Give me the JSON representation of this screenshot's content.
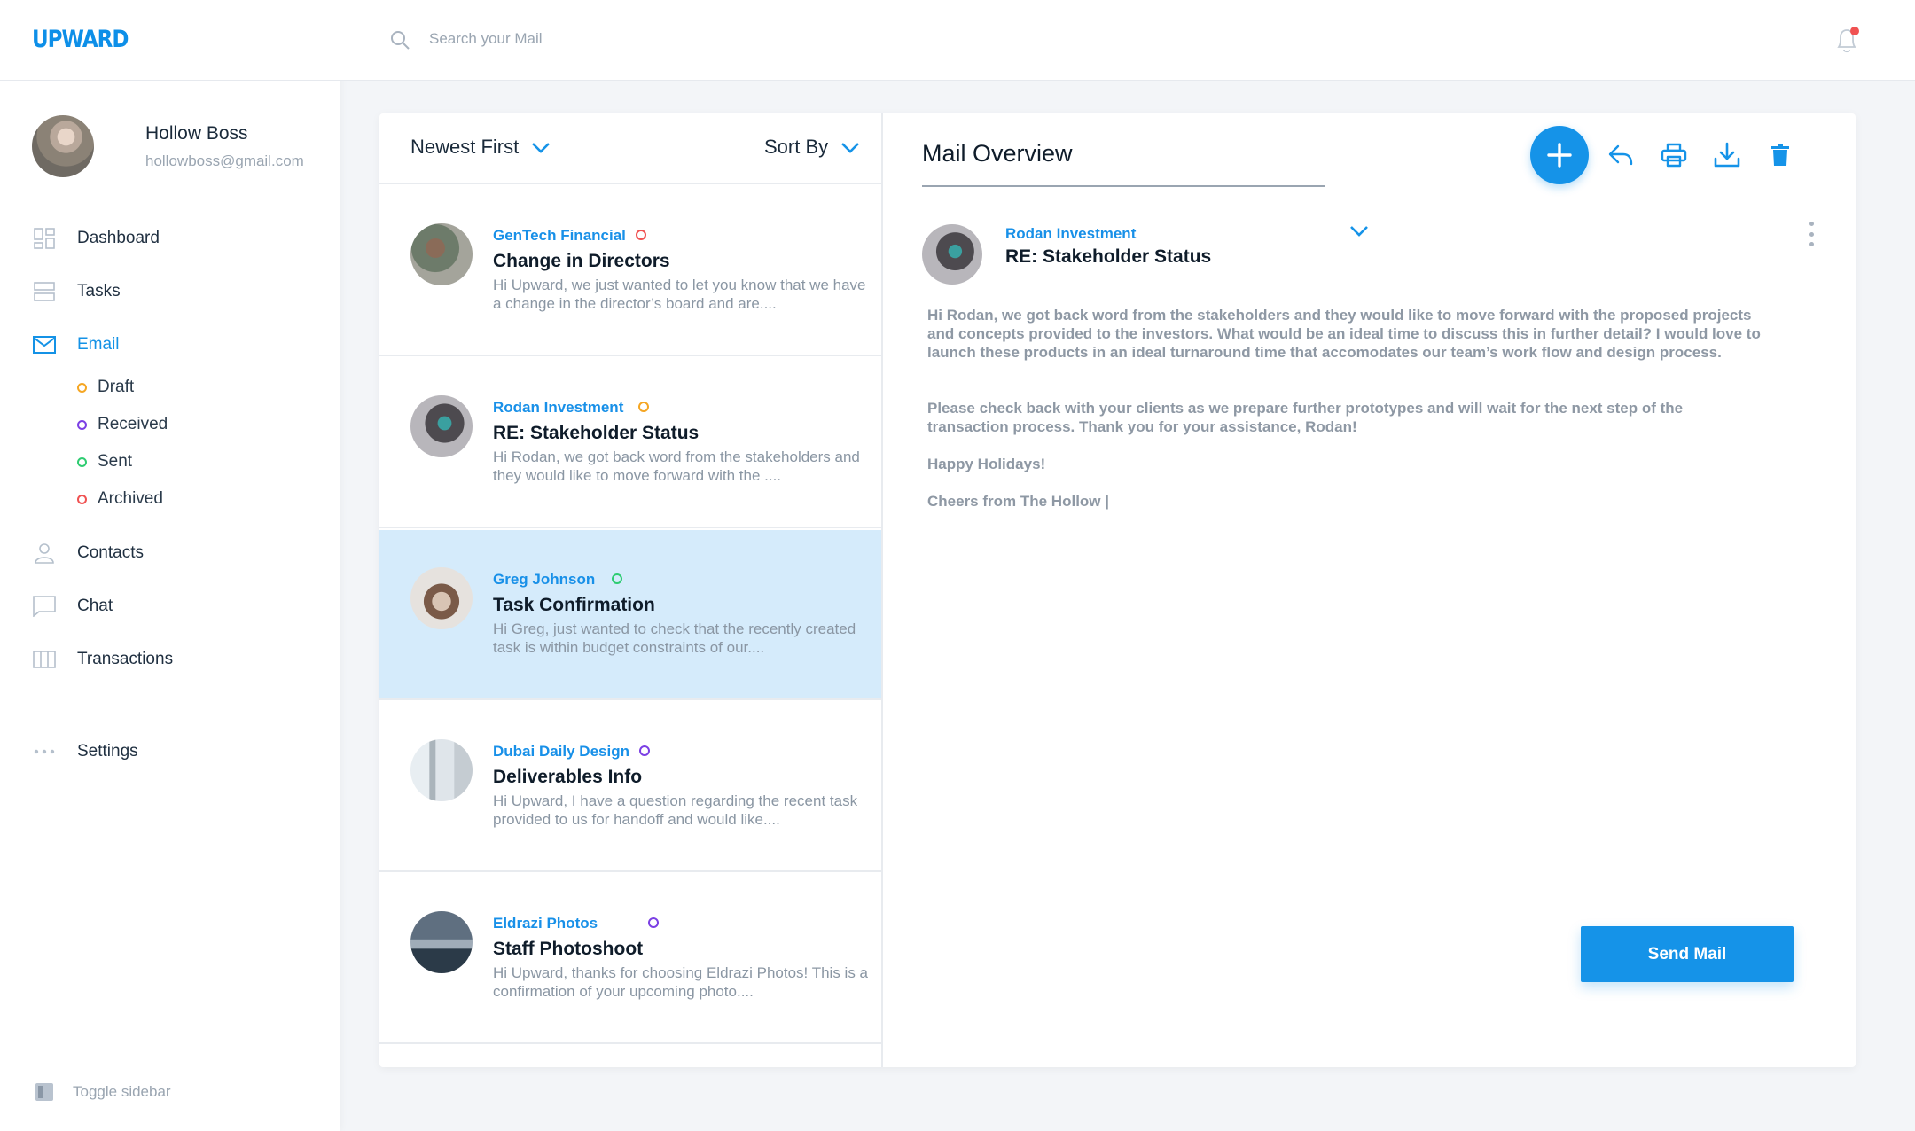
{
  "app": {
    "logo": "UPWARD"
  },
  "profile": {
    "name": "Hollow Boss",
    "email": "hollowboss@gmail.com"
  },
  "nav": {
    "dashboard": "Dashboard",
    "tasks": "Tasks",
    "email": "Email",
    "email_sub": [
      {
        "label": "Draft",
        "color": "#f5a623"
      },
      {
        "label": "Received",
        "color": "#7b3fe4"
      },
      {
        "label": "Sent",
        "color": "#2ecc71"
      },
      {
        "label": "Archived",
        "color": "#f05252"
      }
    ],
    "contacts": "Contacts",
    "chat": "Chat",
    "transactions": "Transactions",
    "settings": "Settings",
    "toggle_sidebar": "Toggle sidebar"
  },
  "search": {
    "placeholder": "Search your Mail",
    "value": ""
  },
  "notifications": {
    "has_unread": true,
    "dot_color": "#f05252"
  },
  "list": {
    "sort_order": "Newest First",
    "sort_by": "Sort By",
    "items": [
      {
        "sender": "GenTech Financial",
        "subject": "Change in Directors",
        "preview": "Hi Upward, we just wanted to let you know that we have a change in the director’s board and are....",
        "tag_color": "#f05252",
        "selected": false
      },
      {
        "sender": "Rodan Investment",
        "subject": "RE: Stakeholder Status",
        "preview": "Hi Rodan, we got back word from the stakeholders and they would like to move forward with the ....",
        "tag_color": "#f5a623",
        "selected": false
      },
      {
        "sender": "Greg Johnson",
        "subject": "Task Confirmation",
        "preview": "Hi Greg, just wanted to check that the recently created task is within budget constraints of our....",
        "tag_color": "#2ecc71",
        "selected": true
      },
      {
        "sender": "Dubai Daily Design",
        "subject": "Deliverables Info",
        "preview": "Hi Upward, I have a question regarding the recent task provided to us for handoff and would like....",
        "tag_color": "#7b3fe4",
        "selected": false
      },
      {
        "sender": "Eldrazi Photos",
        "subject": "Staff Photoshoot",
        "preview": "Hi Upward, thanks for choosing Eldrazi Photos! This is a confirmation of your upcoming photo....",
        "tag_color": "#7b3fe4",
        "selected": false
      }
    ]
  },
  "detail": {
    "title": "Mail Overview",
    "sender": "Rodan Investment",
    "subject": "RE: Stakeholder Status",
    "body": [
      "Hi Rodan, we got back word from the stakeholders and they would like to move forward with the proposed projects and concepts provided to the investors. What would be an ideal time to discuss this in further detail? I would love to launch these products in an ideal turnaround time that accomodates our team’s work flow and design process.",
      "Please check back with your clients as we prepare further prototypes and will wait for the next step of the transaction process. Thank you for your assistance, Rodan!",
      "Happy Holidays!",
      "Cheers from The Hollow |"
    ],
    "send_label": "Send Mail"
  },
  "colors": {
    "accent": "#1593e8",
    "selected_row": "#d5ebfb",
    "text_muted": "#8e98a4"
  }
}
